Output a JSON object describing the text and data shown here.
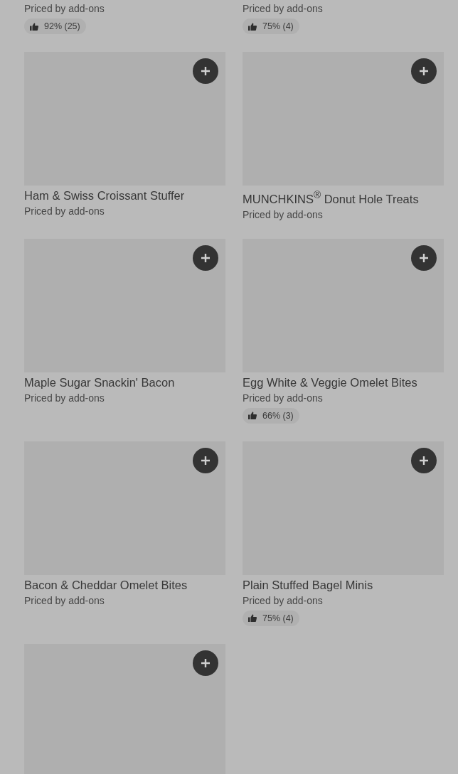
{
  "items": [
    {
      "kind": "partial",
      "price": "Priced by add-ons",
      "rating": "92% (25)"
    },
    {
      "kind": "partial",
      "price": "Priced by add-ons",
      "rating": "75% (4)"
    },
    {
      "kind": "card",
      "name": "Ham & Swiss Croissant Stuffer",
      "price": "Priced by add-ons"
    },
    {
      "kind": "card",
      "name": "MUNCHKINS$^{®}$ Donut Hole Treats",
      "price": "Priced by add-ons"
    },
    {
      "kind": "card",
      "name": "Maple Sugar Snackin' Bacon",
      "price": "Priced by add-ons"
    },
    {
      "kind": "card",
      "name": "Egg White & Veggie Omelet Bites",
      "price": "Priced by add-ons",
      "rating": "66% (3)"
    },
    {
      "kind": "card",
      "name": "Bacon & Cheddar Omelet Bites",
      "price": "Priced by add-ons"
    },
    {
      "kind": "card",
      "name": "Plain Stuffed Bagel Minis",
      "price": "Priced by add-ons",
      "rating": "75% (4)"
    },
    {
      "kind": "image_only"
    }
  ]
}
